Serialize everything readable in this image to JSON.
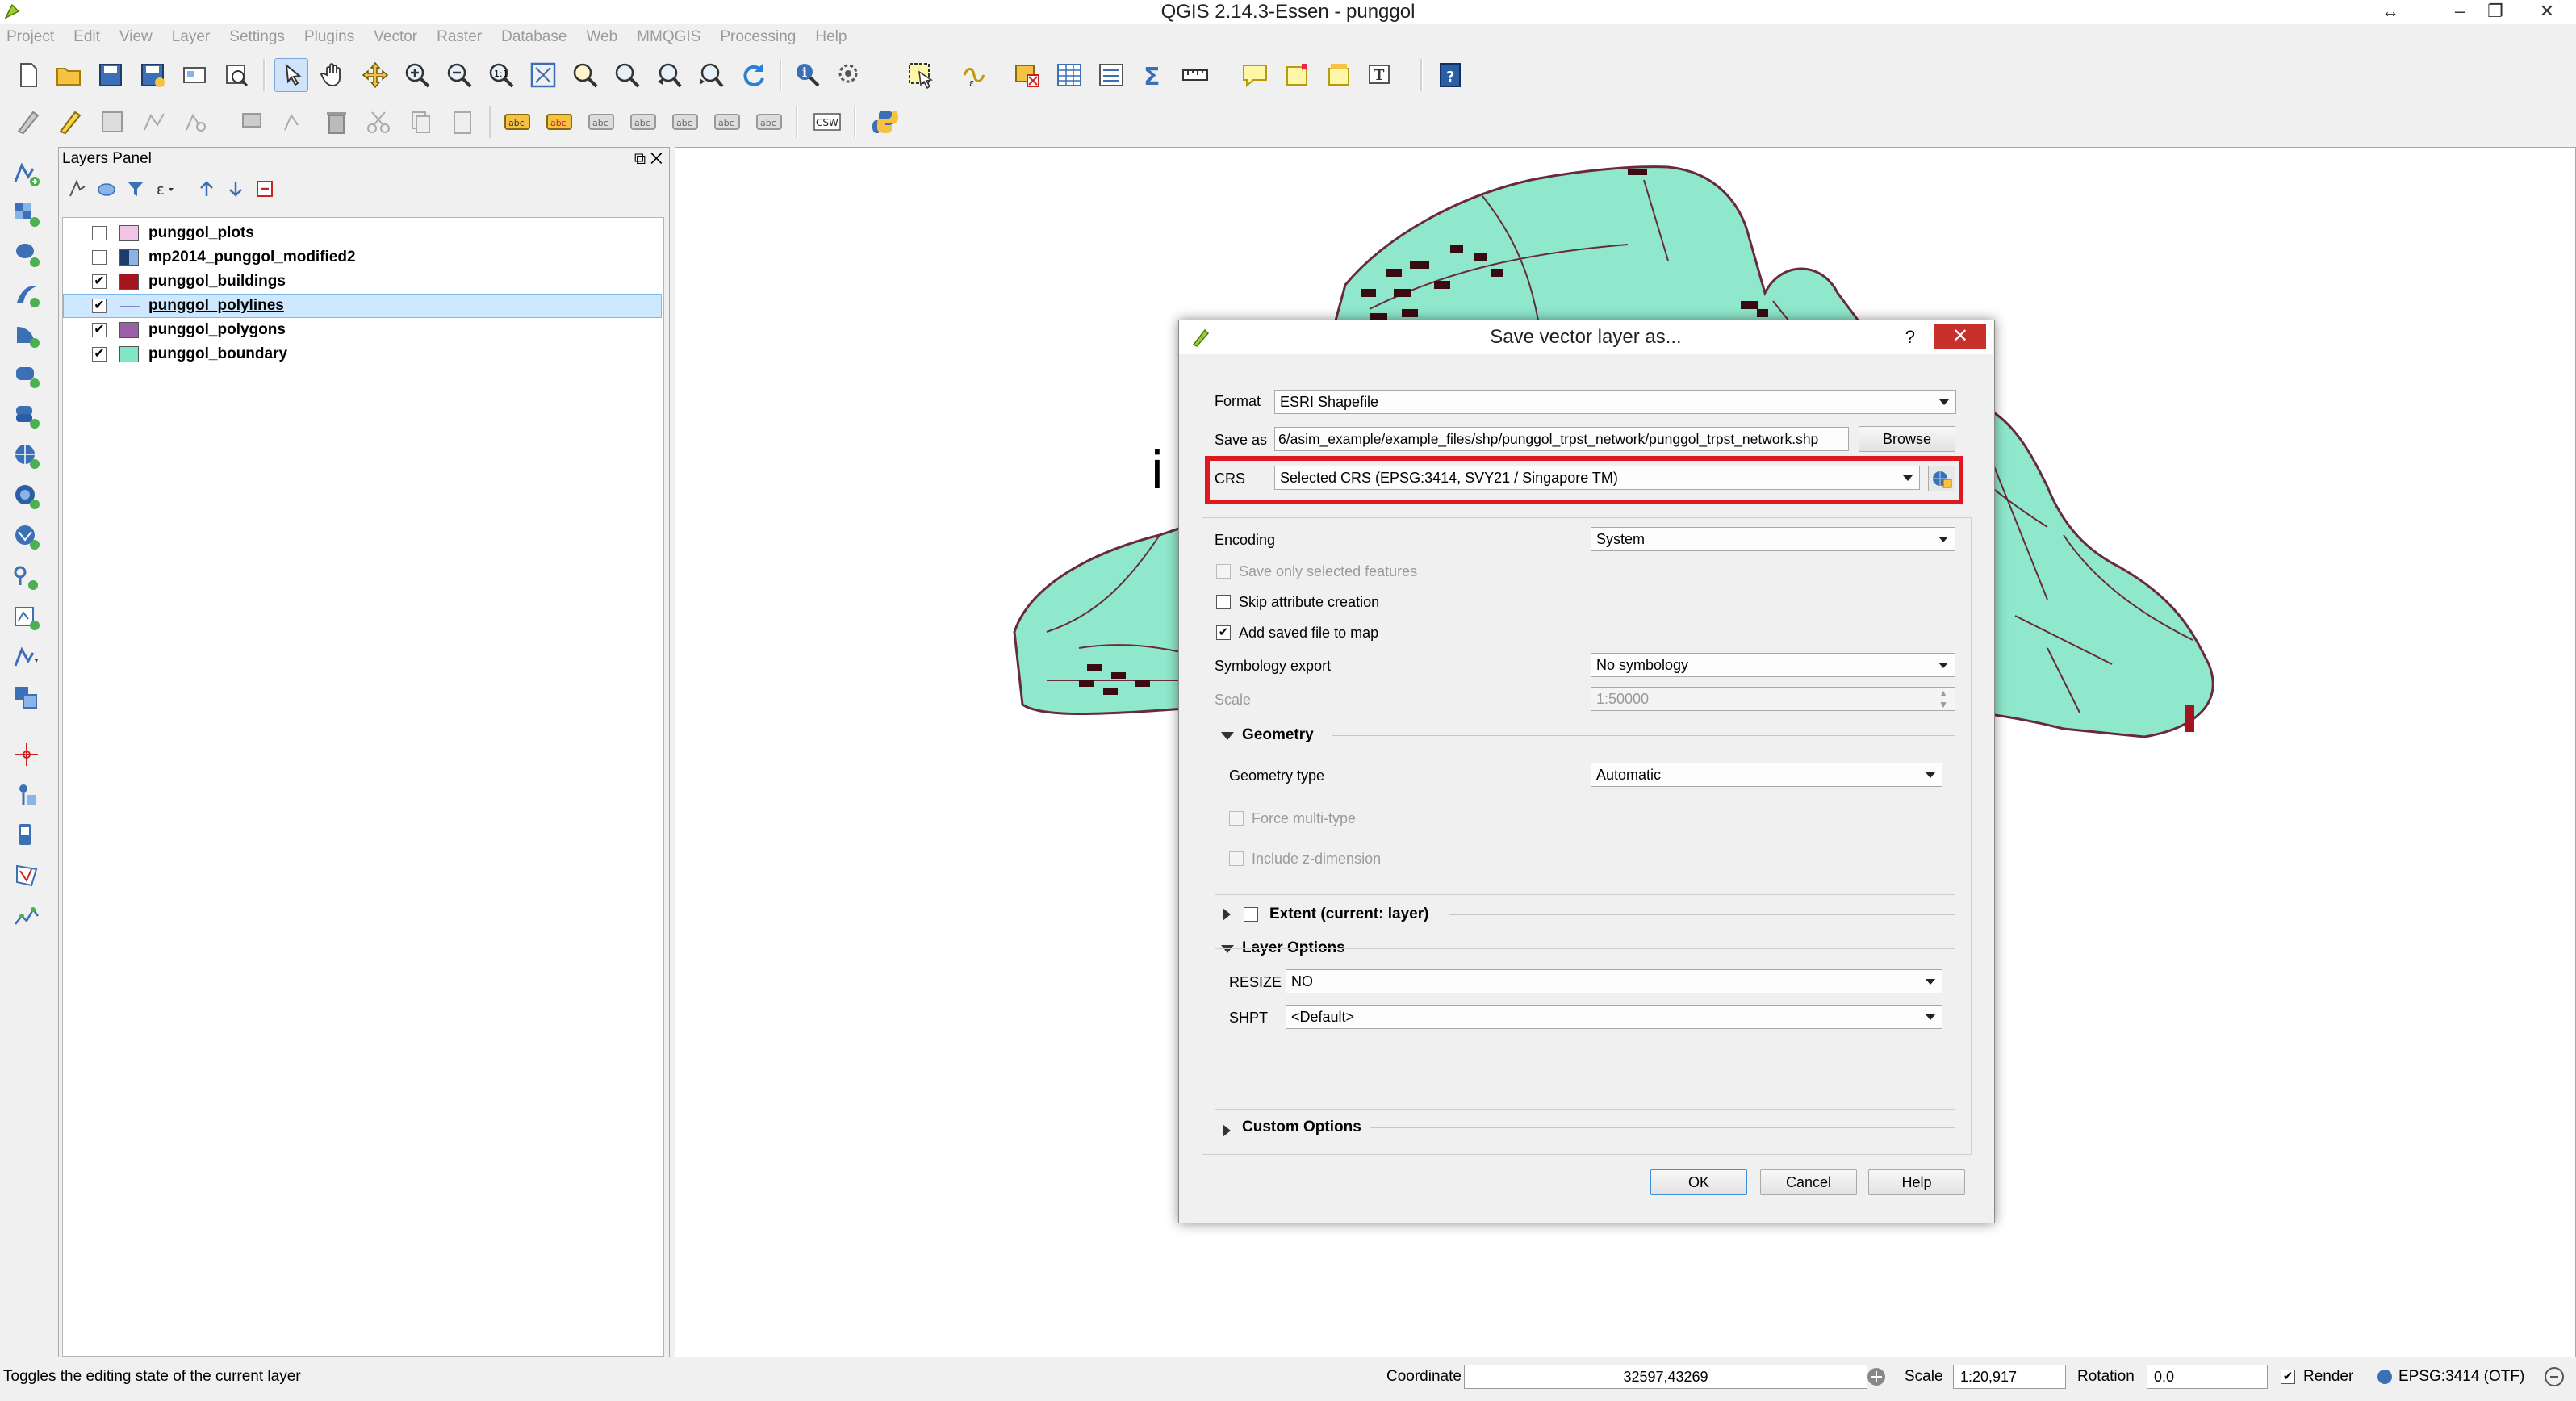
{
  "window": {
    "title": "QGIS 2.14.3-Essen - punggol"
  },
  "menubar": {
    "items": [
      "Project",
      "Edit",
      "View",
      "Layer",
      "Settings",
      "Plugins",
      "Vector",
      "Raster",
      "Database",
      "Web",
      "MMQGIS",
      "Processing",
      "Help"
    ]
  },
  "toolbar2": {
    "csw_label": "CSW"
  },
  "layers_panel": {
    "title": "Layers Panel",
    "layers": [
      {
        "name": "punggol_plots",
        "checked": false,
        "color": "#f0c6e6"
      },
      {
        "name": "mp2014_punggol_modified2",
        "checked": false,
        "color": "raster"
      },
      {
        "name": "punggol_buildings",
        "checked": true,
        "color": "#a3141f"
      },
      {
        "name": "punggol_polylines",
        "checked": true,
        "color": "line",
        "selected": true
      },
      {
        "name": "punggol_polygons",
        "checked": true,
        "color": "#9b5fa6"
      },
      {
        "name": "punggol_boundary",
        "checked": true,
        "color": "#7fe6c7"
      }
    ]
  },
  "map": {
    "fill_color": "#8fe8cc",
    "outline_color": "#6a2a3e",
    "building_color": "#3a0b10",
    "cursor_glyph": "i"
  },
  "dialog": {
    "title": "Save vector layer as...",
    "help": "?",
    "close": "✕",
    "format_label": "Format",
    "format_value": "ESRI Shapefile",
    "saveas_label": "Save as",
    "saveas_value": "6/asim_example/example_files/shp/punggol_trpst_network/punggol_trpst_network.shp",
    "browse_label": "Browse",
    "crs_label": "CRS",
    "crs_value": "Selected CRS (EPSG:3414, SVY21 / Singapore TM)",
    "encoding_label": "Encoding",
    "encoding_value": "System",
    "save_selected_label": "Save only selected features",
    "skip_attr_label": "Skip attribute creation",
    "add_saved_label": "Add saved file to map",
    "symbology_label": "Symbology export",
    "symbology_value": "No symbology",
    "scale_label": "Scale",
    "scale_value": "1:50000",
    "geometry_header": "Geometry",
    "geometry_type_label": "Geometry type",
    "geometry_type_value": "Automatic",
    "force_multi_label": "Force multi-type",
    "include_z_label": "Include z-dimension",
    "extent_label": "Extent (current: layer)",
    "layer_options_header": "Layer Options",
    "resize_label": "RESIZE",
    "resize_value": "NO",
    "shpt_label": "SHPT",
    "shpt_value": "<Default>",
    "custom_options_header": "Custom Options",
    "ok_label": "OK",
    "cancel_label": "Cancel",
    "help_label": "Help"
  },
  "statusbar": {
    "message": "Toggles the editing state of the current layer",
    "coordinate_label": "Coordinate",
    "coordinate_value": "32597,43269",
    "scale_label": "Scale",
    "scale_value": "1:20,917",
    "rotation_label": "Rotation",
    "rotation_value": "0.0",
    "render_label": "Render",
    "crs_label": "EPSG:3414 (OTF)"
  }
}
